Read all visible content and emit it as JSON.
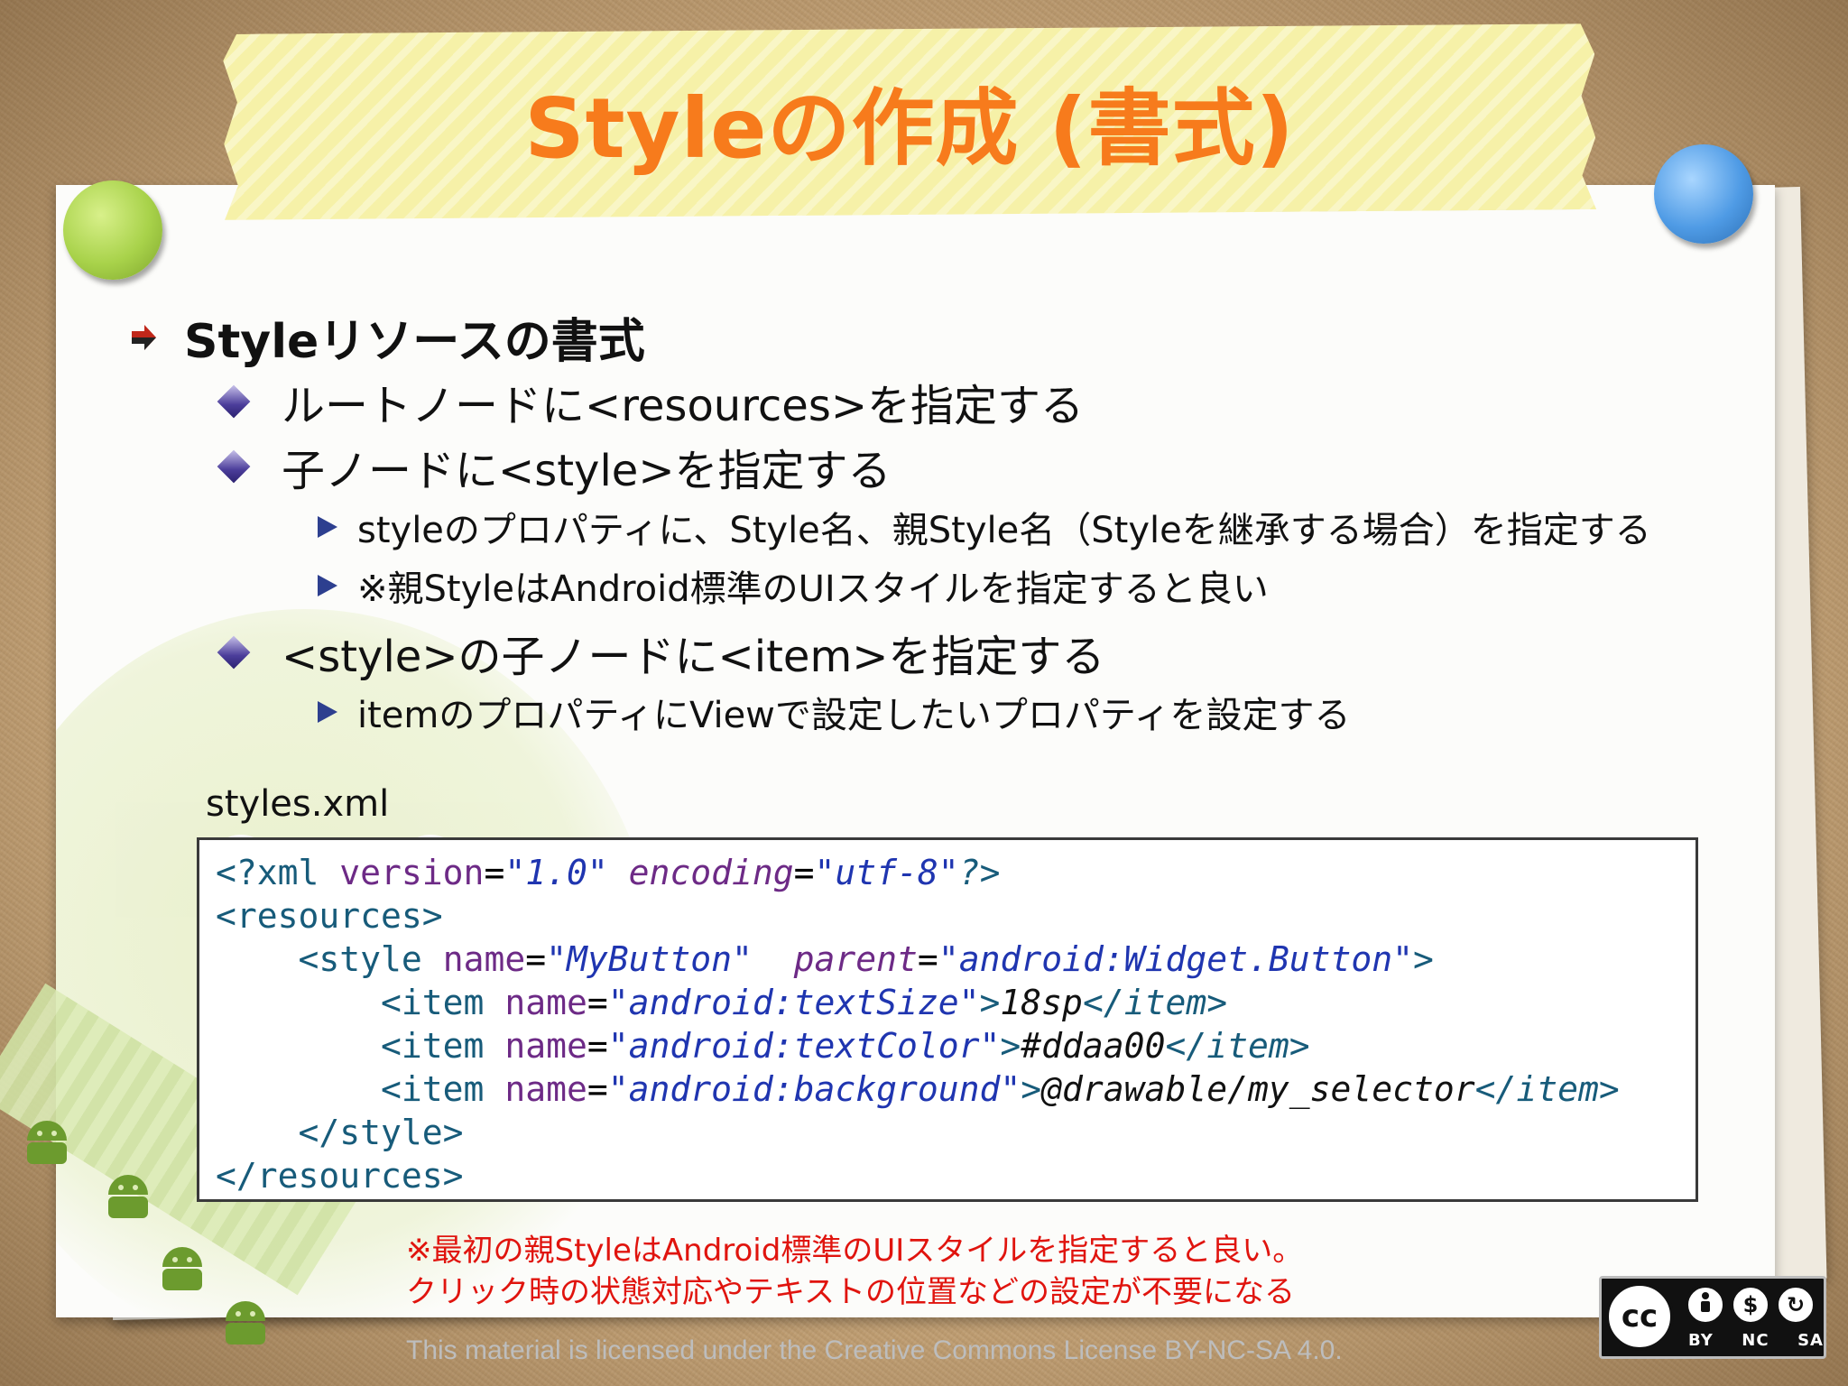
{
  "slide": {
    "title": "Styleの作成 (書式)",
    "bullets": {
      "level1": "Styleリソースの書式",
      "item_root": "ルートノードに<resources>を指定する",
      "item_child": "子ノードに<style>を指定する",
      "sub_style_props": "styleのプロパティに、Style名、親Style名（Styleを継承する場合）を指定する",
      "sub_parent_note": "※親StyleはAndroid標準のUIスタイルを指定すると良い",
      "item_style_child": "<style>の子ノードに<item>を指定する",
      "sub_item_props": "itemのプロパティにViewで設定したいプロパティを設定する"
    },
    "code": {
      "filename": "styles.xml",
      "decl_open": "<?xml",
      "decl_version_attr": "version",
      "decl_version_val": "\"1.0\"",
      "decl_encoding_attr": "encoding",
      "decl_encoding_val": "\"utf-8\"",
      "decl_close": "?>",
      "resources_open": "<resources>",
      "style_open": "<style",
      "name_attr": "name",
      "style_name_val": "\"MyButton\"",
      "parent_attr": "parent",
      "parent_val": "\"android:Widget.Button\"",
      "gt": ">",
      "item_open": "<item",
      "item1_name": "\"android:textSize\"",
      "item1_value": "18sp",
      "item2_name": "\"android:textColor\"",
      "item2_value": "#ddaa00",
      "item3_name": "\"android:background\"",
      "item3_value": "@drawable/my_selector",
      "item_close": "</item>",
      "style_close": "</style>",
      "resources_close": "</resources>"
    },
    "note_line1": "※最初の親StyleはAndroid標準のUIスタイルを指定すると良い。",
    "note_line2": "クリック時の状態対応やテキストの位置などの設定が不要になる",
    "license_text": "This material is licensed under the Creative Commons License BY-NC-SA 4.0.",
    "cc_badge": {
      "cc": "cc",
      "labels": [
        "BY",
        "NC",
        "SA"
      ]
    }
  },
  "colors": {
    "title": "#f77b1c",
    "note": "#e0140e",
    "tag": "#175b7a",
    "attr": "#6d2a86",
    "value": "#1f35b0"
  },
  "icons": [
    "red-arrow-bullet-icon",
    "purple-diamond-bullet-icon",
    "blue-triangle-bullet-icon",
    "creative-commons-icon",
    "android-robot-icon"
  ]
}
